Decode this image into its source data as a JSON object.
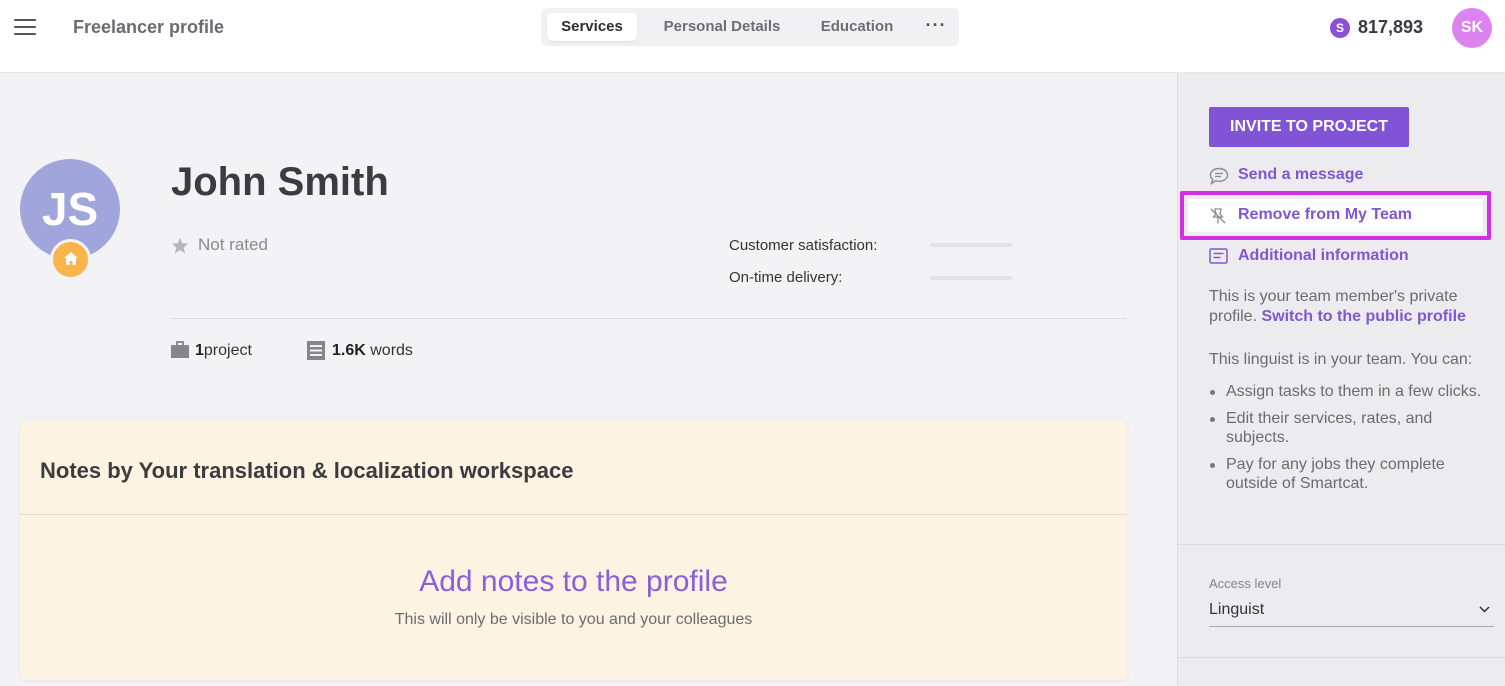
{
  "header": {
    "title": "Freelancer profile",
    "tabs": [
      {
        "label": "Services",
        "active": true
      },
      {
        "label": "Personal Details",
        "active": false
      },
      {
        "label": "Education",
        "active": false
      }
    ],
    "more_label": "···",
    "balance": {
      "coin_symbol": "S",
      "value": "817,893"
    },
    "user_initials": "SK"
  },
  "profile": {
    "initials": "JS",
    "name": "John Smith",
    "rating": "Not rated",
    "metrics": {
      "customer_satisfaction_label": "Customer satisfaction:",
      "on_time_delivery_label": "On-time delivery:"
    },
    "stats": {
      "projects_count": "1",
      "projects_label": "project",
      "words_count": "1.6K",
      "words_label": " words"
    }
  },
  "notes": {
    "title": "Notes by Your translation & localization workspace",
    "add_label": "Add notes to the profile",
    "hint": "This will only be visible to you and your colleagues"
  },
  "sidebar": {
    "invite_label": "INVITE TO PROJECT",
    "send_message": "Send a message",
    "remove_from_team": "Remove from My Team",
    "additional_info": "Additional information",
    "private_text": "This is your team member's private profile. ",
    "switch_link": "Switch to the public profile",
    "team_text": "This linguist is in your team. You can:",
    "bullets": [
      "Assign tasks to them in a few clicks.",
      "Edit their services, rates, and subjects.",
      "Pay for any jobs they complete outside of Smartcat."
    ],
    "access_level_label": "Access level",
    "access_level_value": "Linguist"
  },
  "colors": {
    "accent": "#8153d6",
    "link": "#7f57d1",
    "highlight": "#d22ee6",
    "avatar_bg": "#a0a6dc",
    "user_avatar_bg": "#dd83f0",
    "notes_bg": "#fdf3e2",
    "home_badge": "#f9b44c"
  },
  "icons": [
    "menu-icon",
    "coin-icon",
    "star-icon",
    "home-icon",
    "briefcase-icon",
    "document-icon",
    "chat-bubble-icon",
    "unpin-icon",
    "info-list-icon",
    "chevron-down-icon"
  ]
}
